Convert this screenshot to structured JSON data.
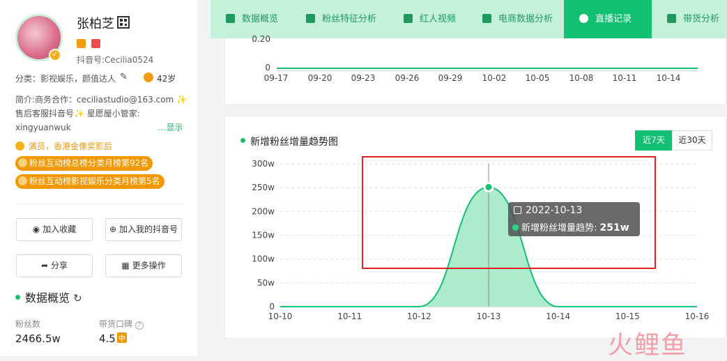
{
  "profile": {
    "name": "张柏芝",
    "douyin_id": "抖音号:Cecilia0524",
    "category": "分类：影视娱乐，颜值达人",
    "age": "42岁",
    "bio_line1": "简介:商务合作：ceciliastudio@163.com ✨",
    "bio_line2": "售后客服抖音号✨ 星愿屋小管家:",
    "bio_line3": "xingyuanwuk",
    "bio_more": "...显示",
    "honor": "演员，香港金像奖影后",
    "rank1": "粉丝互动榜总榜分类月榜第92名",
    "rank2": "粉丝互动榜影视娱乐分类月榜第5名"
  },
  "actions": {
    "favorite": "加入收藏",
    "add_mine": "加入我的抖音号",
    "share": "分享",
    "more": "更多操作"
  },
  "overview": {
    "title": "数据概览",
    "fans_label": "粉丝数",
    "fans_value": "2466.5w",
    "rep_label": "带货口碑",
    "rep_value": "4.5",
    "rep_tag": "中"
  },
  "tabs": [
    {
      "label": "数据概览",
      "icon": "pie-icon"
    },
    {
      "label": "粉丝特征分析",
      "icon": "id-card-icon"
    },
    {
      "label": "红人视频",
      "icon": "video-icon"
    },
    {
      "label": "电商数据分析",
      "icon": "cart-icon"
    },
    {
      "label": "直播记录",
      "icon": "clock-icon",
      "active": true
    },
    {
      "label": "带货分析",
      "icon": "bag-icon"
    }
  ],
  "top_chart": {
    "y_ticks": [
      "0.20",
      "0"
    ],
    "x_ticks": [
      "09-17",
      "09-20",
      "09-23",
      "09-26",
      "09-29",
      "10-02",
      "10-05",
      "10-08",
      "10-11",
      "10-14"
    ]
  },
  "fan_chart": {
    "title": "新增粉丝增量趋势图",
    "range_7": "近7天",
    "range_30": "近30天",
    "tooltip_date": "2022-10-13",
    "tooltip_label": "新增粉丝增量趋势:",
    "tooltip_value": "251w"
  },
  "chart_data": {
    "type": "area",
    "title": "新增粉丝增量趋势图",
    "x": [
      "10-10",
      "10-11",
      "10-12",
      "10-13",
      "10-14",
      "10-15",
      "10-16"
    ],
    "y_ticks": [
      "0",
      "50w",
      "100w",
      "150w",
      "200w",
      "250w",
      "300w"
    ],
    "ylim": [
      0,
      300
    ],
    "series": [
      {
        "name": "新增粉丝增量趋势",
        "values": [
          0,
          0,
          0,
          251,
          0,
          0,
          0
        ],
        "color": "#12c072"
      }
    ],
    "grid": true,
    "legend": "none"
  },
  "watermark": "火鲤鱼",
  "colors": {
    "accent": "#12c072",
    "tab_bg": "#c5f0d9",
    "rank_bg": "#f39800",
    "highlight_box": "#e02222"
  }
}
